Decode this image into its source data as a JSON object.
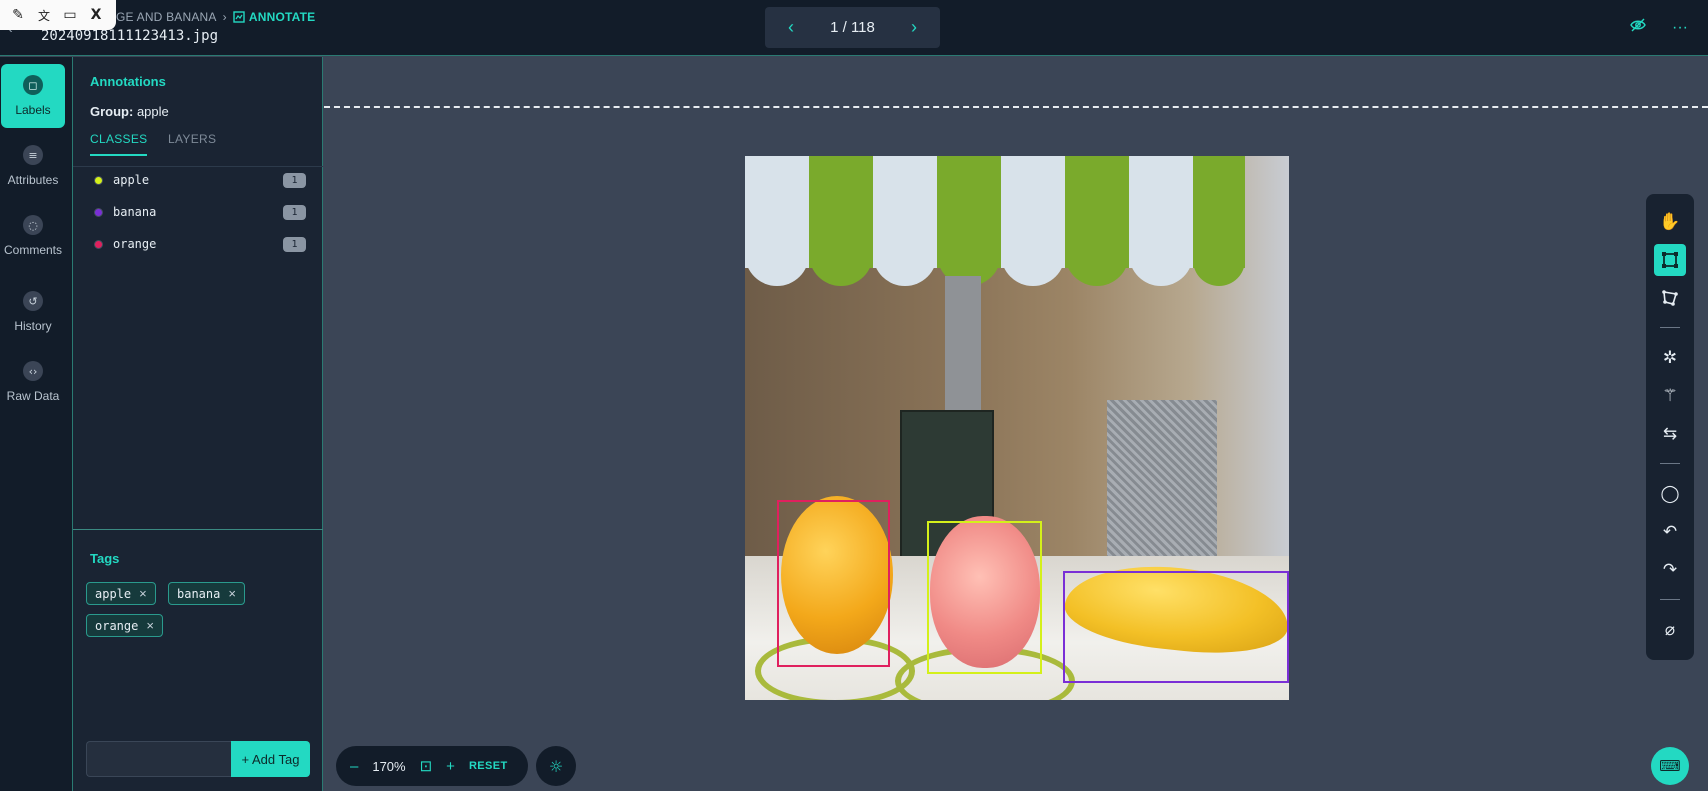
{
  "header": {
    "breadcrumb_project": "GE AND BANANA",
    "breadcrumb_sep": "›",
    "breadcrumb_active": "ANNOTATE",
    "filename": "20240918111123413.jpg",
    "pager": {
      "prev": "‹",
      "count": "1 / 118",
      "next": "›"
    },
    "icons": [
      "eye-off-icon",
      "more-icon"
    ]
  },
  "mini_toolbar": [
    "highlighter-icon",
    "translate-icon",
    "bookmark-icon",
    "x-logo-icon"
  ],
  "rail": [
    {
      "label": "Labels",
      "icon": "label-icon",
      "active": true
    },
    {
      "label": "Attributes",
      "icon": "list-icon",
      "active": false
    },
    {
      "label": "Comments",
      "icon": "comment-icon",
      "active": false
    },
    {
      "label": "History",
      "icon": "history-icon",
      "active": false
    },
    {
      "label": "Raw Data",
      "icon": "code-icon",
      "active": false
    }
  ],
  "panel": {
    "title": "Annotations",
    "group_label": "Group:",
    "group_value": "apple",
    "tabs": [
      "CLASSES",
      "LAYERS"
    ],
    "classes": [
      {
        "name": "apple",
        "count": "1",
        "color": "#d4f01a"
      },
      {
        "name": "banana",
        "count": "1",
        "color": "#7a2fd6"
      },
      {
        "name": "orange",
        "count": "1",
        "color": "#e0205e"
      }
    ],
    "tags_title": "Tags",
    "tags": [
      "apple",
      "banana",
      "orange"
    ],
    "tag_remove": "×",
    "tag_input_placeholder": "",
    "add_tag_label": "+ Add Tag"
  },
  "annotations": [
    {
      "label": "orange",
      "color": "#e0205e"
    },
    {
      "label": "apple",
      "color": "#d4f01a"
    },
    {
      "label": "banana",
      "color": "#7a2fd6"
    }
  ],
  "right_toolbar": [
    "hand-icon",
    "bounding-box-icon",
    "polygon-icon",
    "auto-annotate-icon",
    "magic-wand-icon",
    "swap-icon",
    "comment-icon",
    "undo-icon",
    "redo-icon",
    "hide-icon"
  ],
  "zoom": {
    "minus": "–",
    "value": "170%",
    "lock": "⊡",
    "plus": "+",
    "reset": "RESET"
  },
  "colors": {
    "accent": "#23d9c2",
    "bg": "#3b4556",
    "surface": "#121c29"
  }
}
